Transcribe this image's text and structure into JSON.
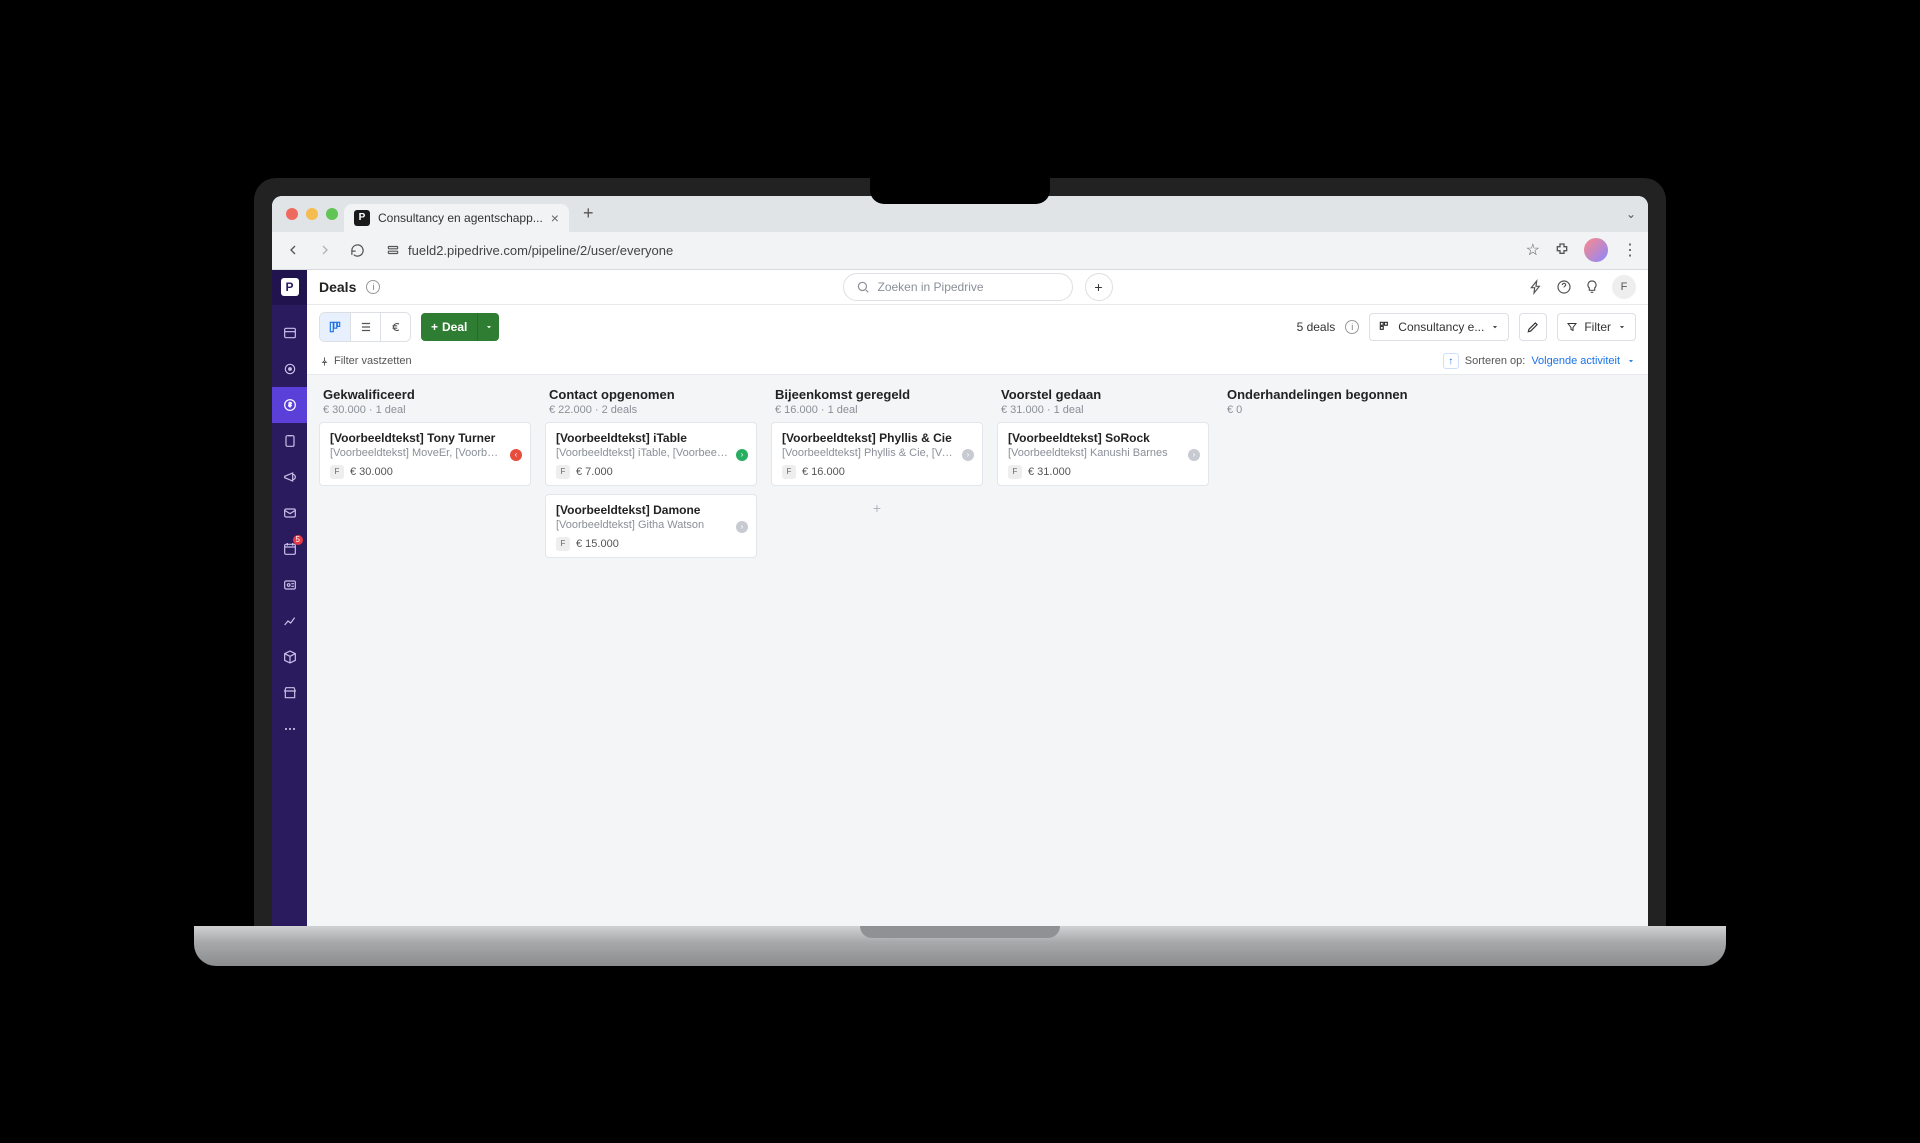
{
  "browser": {
    "tab_title": "Consultancy en agentschapp...",
    "url": "fueld2.pipedrive.com/pipeline/2/user/everyone"
  },
  "app": {
    "title": "Deals",
    "search_placeholder": "Zoeken in Pipedrive",
    "deal_button": "Deal",
    "deals_count_label": "5 deals",
    "pipeline_name": "Consultancy e...",
    "filter_label": "Filter",
    "pin_filter": "Filter vastzetten",
    "sort_label": "Sorteren op:",
    "sort_value": "Volgende activiteit",
    "user_initial": "F"
  },
  "sidebar": {
    "badge": "5"
  },
  "columns": [
    {
      "title": "Gekwalificeerd",
      "sub": "€ 30.000 · 1 deal",
      "cards": [
        {
          "title": "[Voorbeeldtekst] Tony Turner",
          "org": "[Voorbeeldtekst] MoveEr, [Voorbeeldtekst] To...",
          "amount": "€ 30.000",
          "status": "red"
        }
      ]
    },
    {
      "title": "Contact opgenomen",
      "sub": "€ 22.000 · 2 deals",
      "cards": [
        {
          "title": "[Voorbeeldtekst] iTable",
          "org": "[Voorbeeldtekst] iTable, [Voorbeeldtekst] Otto...",
          "amount": "€ 7.000",
          "status": "green"
        },
        {
          "title": "[Voorbeeldtekst] Damone",
          "org": "[Voorbeeldtekst] Githa Watson",
          "amount": "€ 15.000",
          "status": "gray"
        }
      ]
    },
    {
      "title": "Bijeenkomst geregeld",
      "sub": "€ 16.000 · 1 deal",
      "cards": [
        {
          "title": "[Voorbeeldtekst] Phyllis & Cie",
          "org": "[Voorbeeldtekst] Phyllis & Cie, [Voorbeeldteks...",
          "amount": "€ 16.000",
          "status": "gray"
        }
      ],
      "show_add": true
    },
    {
      "title": "Voorstel gedaan",
      "sub": "€ 31.000 · 1 deal",
      "cards": [
        {
          "title": "[Voorbeeldtekst] SoRock",
          "org": "[Voorbeeldtekst] Kanushi Barnes",
          "amount": "€ 31.000",
          "status": "gray"
        }
      ]
    },
    {
      "title": "Onderhandelingen begonnen",
      "sub": "€ 0",
      "cards": []
    }
  ]
}
